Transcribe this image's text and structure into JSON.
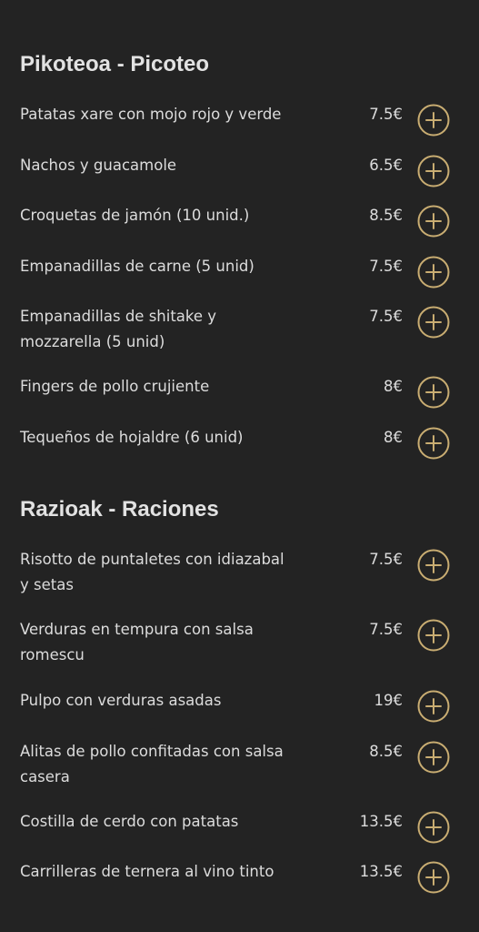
{
  "accent_color": "#c9ad72",
  "sections": [
    {
      "title": "Pikoteoa - Picoteo",
      "items": [
        {
          "name": "Patatas xare con mojo rojo y verde",
          "price": "7.5€",
          "add_icon": "plus-circle-icon"
        },
        {
          "name": "Nachos y guacamole",
          "price": "6.5€",
          "add_icon": "plus-circle-icon"
        },
        {
          "name": "Croquetas de jamón (10 unid.)",
          "price": "8.5€",
          "add_icon": "plus-circle-icon"
        },
        {
          "name": "Empanadillas de carne (5 unid)",
          "price": "7.5€",
          "add_icon": "plus-circle-icon"
        },
        {
          "name": "Empanadillas de shitake y mozzarella (5 unid)",
          "price": "7.5€",
          "add_icon": "plus-circle-icon"
        },
        {
          "name": "Fingers de pollo crujiente",
          "price": "8€",
          "add_icon": "plus-circle-icon"
        },
        {
          "name": "Tequeños de hojaldre (6 unid)",
          "price": "8€",
          "add_icon": "plus-circle-icon"
        }
      ]
    },
    {
      "title": "Razioak - Raciones",
      "items": [
        {
          "name": "Risotto de puntaletes con idiazabal y setas",
          "price": "7.5€",
          "add_icon": "plus-circle-icon"
        },
        {
          "name": "Verduras en tempura con salsa romescu",
          "price": "7.5€",
          "add_icon": "plus-circle-icon"
        },
        {
          "name": "Pulpo con verduras asadas",
          "price": "19€",
          "add_icon": "plus-circle-icon"
        },
        {
          "name": "Alitas de pollo confitadas con salsa casera",
          "price": "8.5€",
          "add_icon": "plus-circle-icon"
        },
        {
          "name": "Costilla de cerdo con patatas",
          "price": "13.5€",
          "add_icon": "plus-circle-icon"
        },
        {
          "name": "Carrilleras de ternera al vino tinto",
          "price": "13.5€",
          "add_icon": "plus-circle-icon"
        }
      ]
    }
  ]
}
